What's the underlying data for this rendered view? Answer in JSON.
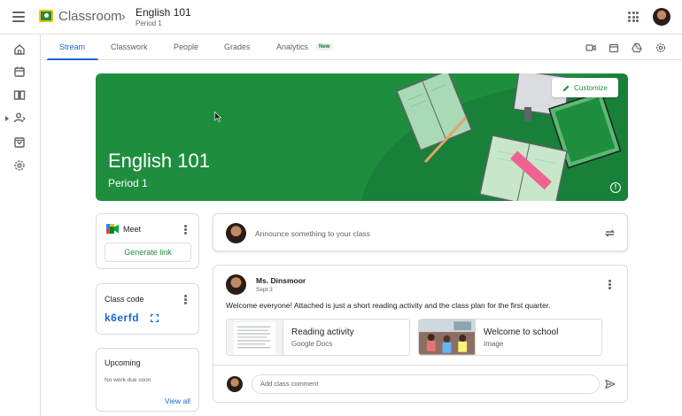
{
  "app": {
    "name": "Classroom",
    "separator": "›"
  },
  "class": {
    "name": "English 101",
    "section": "Period 1"
  },
  "tabs": [
    {
      "label": "Stream"
    },
    {
      "label": "Classwork"
    },
    {
      "label": "People"
    },
    {
      "label": "Grades"
    },
    {
      "label": "Analytics"
    }
  ],
  "analytics_badge": "New",
  "banner": {
    "title": "English 101",
    "subtitle": "Period 1",
    "customize_label": "Customize",
    "info_glyph": "!"
  },
  "meet": {
    "title": "Meet",
    "generate_label": "Generate link"
  },
  "class_code": {
    "title": "Class code",
    "value": "k6erfd"
  },
  "upcoming": {
    "title": "Upcoming",
    "empty_text": "No work due soon",
    "view_all_label": "View all"
  },
  "announce": {
    "placeholder": "Announce something to your class"
  },
  "post": {
    "author": "Ms. Dinsmoor",
    "date": "Sept 3",
    "body": "Welcome everyone! Attached is just a short reading activity and the class plan for the first quarter.",
    "attachments": [
      {
        "title": "Reading activity",
        "type": "Google Docs"
      },
      {
        "title": "Welcome to school",
        "type": "Image"
      }
    ],
    "comment_placeholder": "Add class comment"
  },
  "colors": {
    "accent": "#1967d2",
    "banner": "#1e8e3e",
    "text": "#3c4043"
  }
}
